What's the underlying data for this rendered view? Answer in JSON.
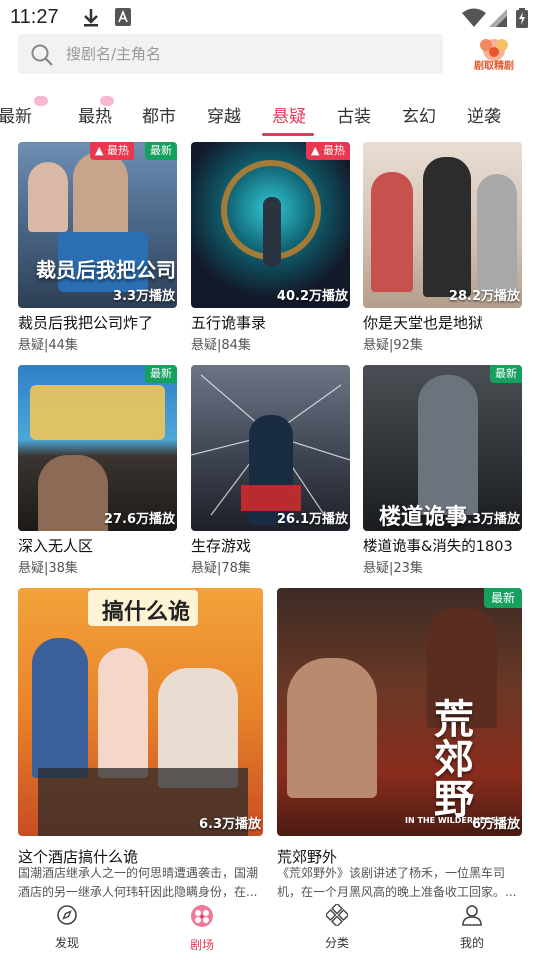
{
  "status_bar": {
    "time": "11:27"
  },
  "search": {
    "placeholder": "搜剧名/主角名"
  },
  "tabs": [
    {
      "label": "最新"
    },
    {
      "label": "最热"
    },
    {
      "label": "都市"
    },
    {
      "label": "穿越"
    },
    {
      "label": "悬疑"
    },
    {
      "label": "古装"
    },
    {
      "label": "玄幻"
    },
    {
      "label": "逆袭"
    }
  ],
  "active_tab": "悬疑",
  "badges": {
    "hot": "最热",
    "new": "最新"
  },
  "cards": [
    {
      "title": "裁员后我把公司炸了",
      "meta": "悬疑|44集",
      "plays": "3.3万播放",
      "badges": [
        "最热",
        "最新"
      ],
      "poster_text": "裁员后我把公司"
    },
    {
      "title": "五行诡事录",
      "meta": "悬疑|84集",
      "plays": "40.2万播放",
      "badges": [
        "最热"
      ],
      "poster_text": ""
    },
    {
      "title": "你是天堂也是地狱",
      "meta": "悬疑|92集",
      "plays": "28.2万播放",
      "badges": [],
      "poster_text": ""
    },
    {
      "title": "深入无人区",
      "meta": "悬疑|38集",
      "plays": "27.6万播放",
      "badges": [
        "最新"
      ],
      "poster_text": ""
    },
    {
      "title": "生存游戏",
      "meta": "悬疑|78集",
      "plays": "26.1万播放",
      "badges": [],
      "poster_text": ""
    },
    {
      "title": "楼道诡事&消失的1803",
      "meta": "悬疑|23集",
      "plays": "9.3万播放",
      "badges": [
        "最新"
      ],
      "poster_text": "楼道诡事"
    },
    {
      "title": "这个酒店搞什么诡",
      "desc": "国潮酒店继承人之一的何思晴遭遇袭击，国潮酒店的另一继承人何玮轩因此隐瞒身份，在...",
      "plays": "6.3万播放",
      "badges": [],
      "poster_text": "搞什么诡"
    },
    {
      "title": "荒郊野外",
      "desc": "《荒郊野外》该剧讲述了杨禾，一位黑车司机，在一个月黑风高的晚上准备收工回家。...",
      "plays": "6万播放",
      "badges": [
        "最新"
      ],
      "poster_text": "荒郊野",
      "poster_subtext": "IN THE WILDERNESS"
    }
  ],
  "bottom_nav": [
    {
      "label": "发现",
      "icon": "compass-icon"
    },
    {
      "label": "剧场",
      "icon": "theater-icon"
    },
    {
      "label": "分类",
      "icon": "category-icon"
    },
    {
      "label": "我的",
      "icon": "person-icon"
    }
  ],
  "colors": {
    "accent": "#e03b58",
    "hot_badge": "#e8374f",
    "new_badge": "#16a05e"
  }
}
